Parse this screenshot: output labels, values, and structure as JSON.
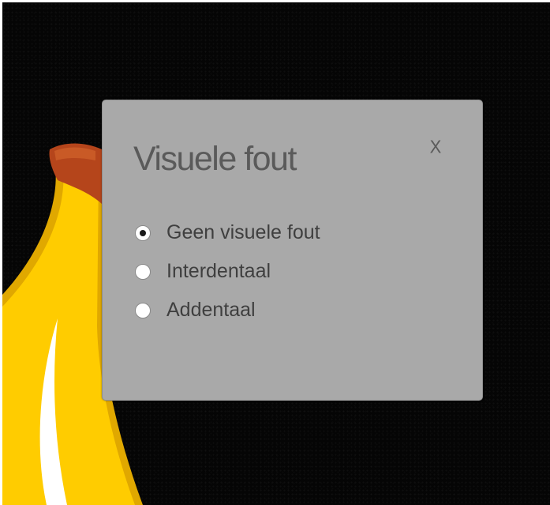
{
  "dialog": {
    "title": "Visuele fout",
    "close_label": "X",
    "options": [
      {
        "label": "Geen visuele fout",
        "checked": true
      },
      {
        "label": "Interdentaal",
        "checked": false
      },
      {
        "label": "Addentaal",
        "checked": false
      }
    ]
  },
  "background": {
    "color": "#050505",
    "illustration": "banana",
    "banana_colors": {
      "peel": "#f5c400",
      "highlight": "#ffffff",
      "stem": "#b5451b"
    }
  },
  "colors": {
    "dialog_bg": "#a9a9a9",
    "title_text": "#5a5a5a",
    "label_text": "#3f3f3f"
  }
}
